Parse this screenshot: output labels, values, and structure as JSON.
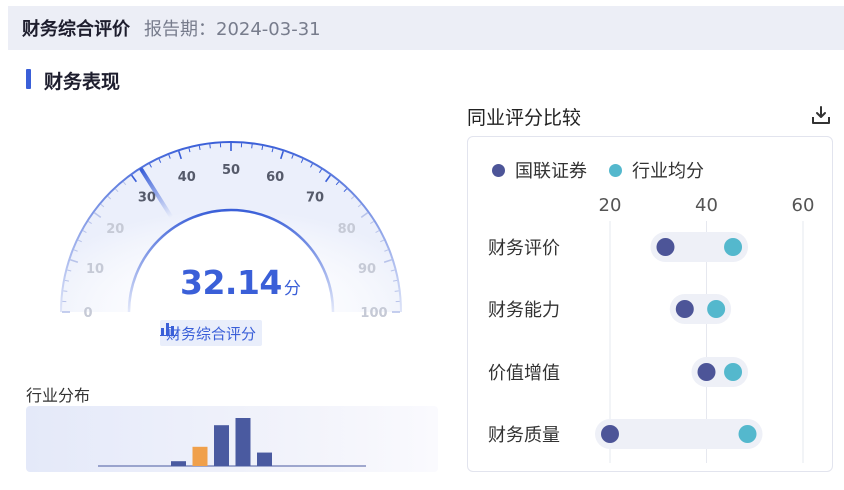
{
  "header": {
    "title": "财务综合评价",
    "period": "报告期：2024-03-31"
  },
  "section": {
    "title": "财务表现"
  },
  "gauge": {
    "score": "32.14",
    "unit": "分",
    "label": "财务综合评分",
    "min": 0,
    "max": 100,
    "ticks": [
      "0",
      "10",
      "20",
      "30",
      "40",
      "50",
      "60",
      "70",
      "80",
      "90",
      "100"
    ],
    "accent": "#3a5fd8"
  },
  "distribution": {
    "title": "行业分布",
    "bins": [
      0.1,
      0.4,
      0.85,
      1.0,
      0.28
    ],
    "highlight_index": 1,
    "bar_color": "#4a5aa0",
    "highlight_color": "#f0a04b"
  },
  "comparison": {
    "title": "同业评分比较",
    "download_icon": "download-icon",
    "legend": [
      {
        "name": "国联证券",
        "color": "#4d5598"
      },
      {
        "name": "行业均分",
        "color": "#54b8cd"
      }
    ],
    "axis_ticks": [
      "20",
      "40",
      "60"
    ],
    "chart_data": {
      "type": "dumbbell",
      "categories": [
        "财务评价",
        "财务能力",
        "价值增值",
        "财务质量"
      ],
      "series": [
        {
          "name": "国联证券",
          "values": [
            31.5,
            35.5,
            40,
            20
          ]
        },
        {
          "name": "行业均分",
          "values": [
            45.5,
            42,
            45.5,
            48.5
          ]
        }
      ],
      "xlim": [
        20,
        60
      ]
    }
  }
}
